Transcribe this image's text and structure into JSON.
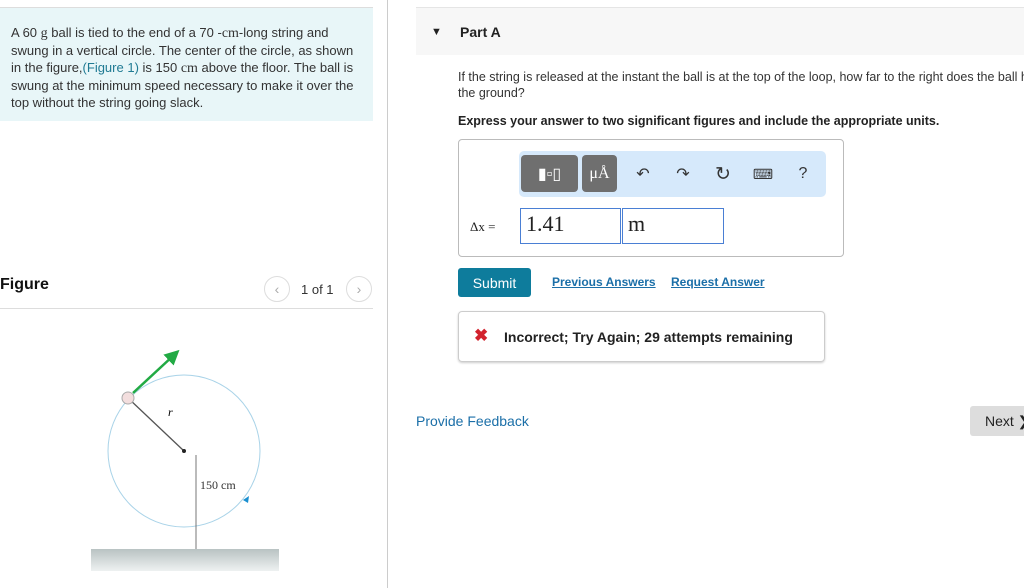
{
  "problem": {
    "t1": "A 60 ",
    "u1": "g",
    "t2": " ball is tied to the end of a 70 -",
    "u2": "cm",
    "t3": "-long string and swung in a vertical circle. The center of the circle, as shown in the figure,",
    "link": "(Figure 1)",
    "t4": " is 150 ",
    "u3": "cm",
    "t5": " above the floor. The ball is swung at the minimum speed necessary to make it over the top without the string going slack."
  },
  "figure": {
    "title": "Figure",
    "count": "1 of 1",
    "r_label": "r",
    "height_label": "150 cm",
    "colors": {
      "arrow": "#22aa44",
      "circle": "#a9d3e8"
    }
  },
  "part": {
    "title": "Part A",
    "question": "If the string is released at the instant the ball is at the top of the loop, how far to the right does the ball hit the ground?",
    "instruction": "Express your answer to two significant figures and include the appropriate units."
  },
  "toolbar": {
    "units_label": "μÅ",
    "help_label": "?"
  },
  "answer": {
    "label": "Δx =",
    "value": "1.41",
    "unit": "m"
  },
  "actions": {
    "submit": "Submit",
    "previous": "Previous Answers",
    "request": "Request Answer"
  },
  "feedback": {
    "text": "Incorrect; Try Again; 29 attempts remaining"
  },
  "footer": {
    "provide_feedback": "Provide Feedback",
    "next": "Next ❯"
  }
}
